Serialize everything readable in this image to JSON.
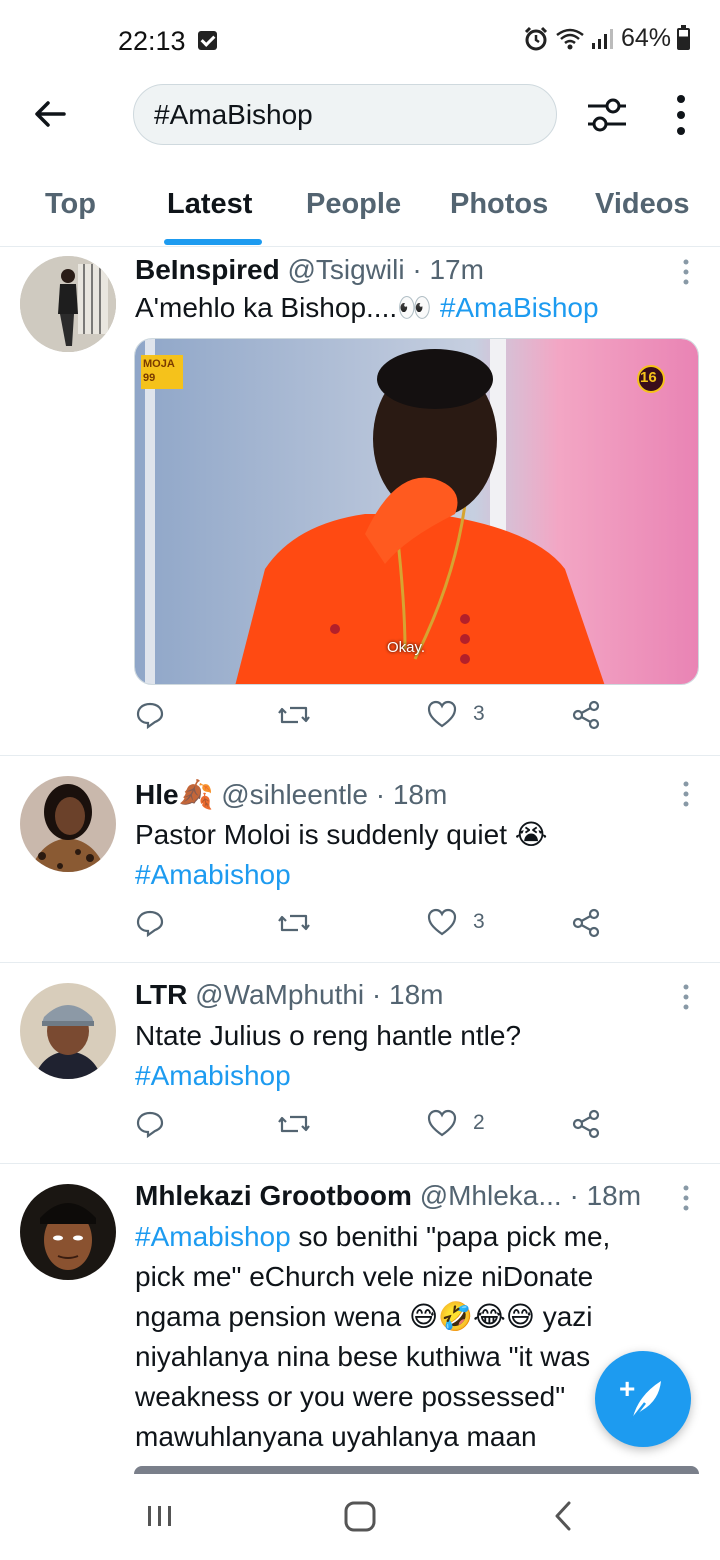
{
  "status_bar": {
    "time": "22:13",
    "battery": "64%"
  },
  "search": {
    "query": "#AmaBishop"
  },
  "tabs": [
    {
      "label": "Top"
    },
    {
      "label": "Latest"
    },
    {
      "label": "People"
    },
    {
      "label": "Photos"
    },
    {
      "label": "Videos"
    }
  ],
  "active_tab": "Latest",
  "tweets": [
    {
      "name": "BeInspired",
      "handle": "@Tsigwili",
      "time": "· 17m",
      "text": "A'mehlo ka Bishop....",
      "emoji": "👀",
      "hashtag": "#AmaBishop",
      "media": {
        "logo": "MOJA 99",
        "badge": "16",
        "caption": "Okay."
      },
      "likes": "3"
    },
    {
      "name": "Hle",
      "name_emoji": "🍂",
      "handle": "@sihleentle",
      "time": "· 18m",
      "text": "Pastor Moloi is suddenly quiet",
      "emoji": "😭",
      "hashtag": "#Amabishop",
      "likes": "3"
    },
    {
      "name": "LTR",
      "handle": "@WaMphuthi",
      "time": "· 18m",
      "text": "Ntate Julius o reng hantle ntle?",
      "hashtag": "#Amabishop",
      "likes": "2"
    },
    {
      "name": "Mhlekazi Grootboom",
      "handle": "@Mhleka...",
      "time": "· 18m",
      "hashtag": "#Amabishop",
      "line1": " so benithi \"papa pick me,",
      "line2": "pick me\" eChurch vele nize niDonate",
      "line3a": "ngama pension wena ",
      "emojis": "😅🤣😂😅",
      "line3b": " yazi",
      "line4": "niyahlanya nina bese kuthiwa \"it was",
      "line5": "weakness or you were possessed\" ",
      "line6": "mawuhlanyana uyahlanya maan"
    }
  ],
  "colors": {
    "accent": "#1d9bf0",
    "text": "#0f1419",
    "muted": "#536471"
  }
}
